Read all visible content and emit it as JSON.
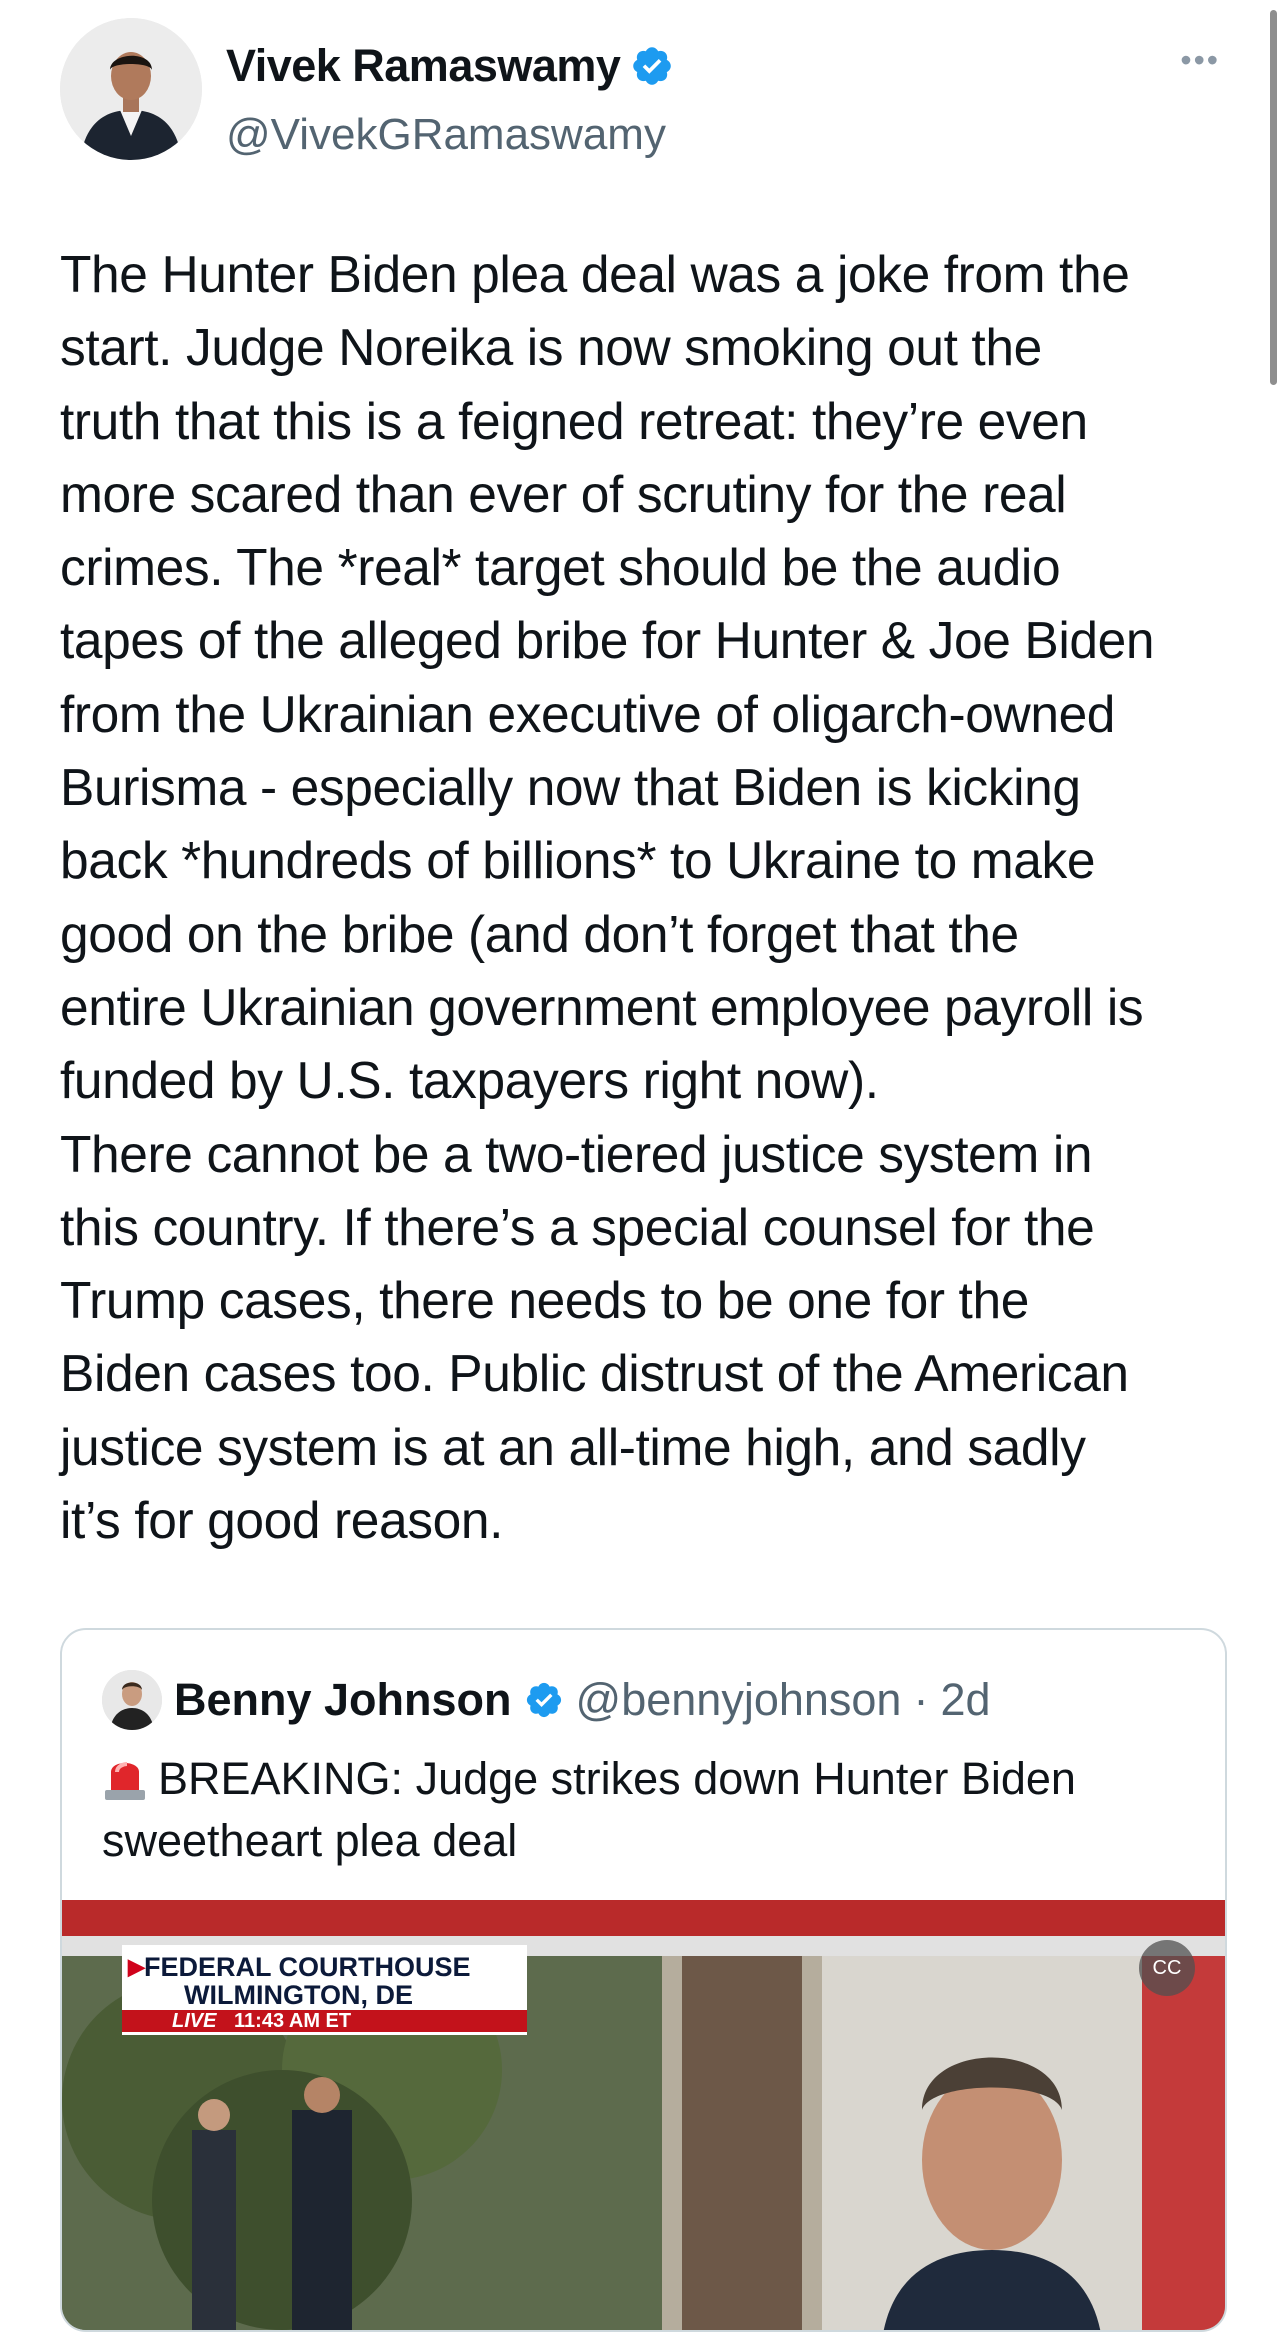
{
  "author": {
    "name": "Vivek Ramaswamy",
    "handle": "@VivekGRamaswamy",
    "verified_icon": "verified-badge-icon",
    "verified_color": "#1d9bf0"
  },
  "more_icon": "more-options-icon",
  "tweet_text": "The Hunter Biden plea deal was a joke from the\nstart. Judge Noreika is now smoking out the\ntruth that this is a feigned retreat: they’re even\nmore scared than ever of scrutiny for the real\ncrimes. The *real* target should be the audio\ntapes of the alleged bribe for Hunter & Joe Biden\nfrom the Ukrainian executive of oligarch-owned\nBurisma - especially now that Biden is kicking\nback *hundreds of billions* to Ukraine to make\ngood on the bribe (and don’t forget that the\nentire Ukrainian government employee payroll is\nfunded by U.S. taxpayers right now).\nThere cannot be a two-tiered justice system in\nthis country. If there’s a special counsel for the\nTrump cases, there needs to be one for the\nBiden cases too. Public distrust of the American\njustice system is at an all-time high, and sadly\nit’s for good reason.",
  "quoted_tweet": {
    "name": "Benny Johnson",
    "handle": "@bennyjohnson",
    "separator": "·",
    "time": "2d",
    "emoji": "siren-emoji",
    "text": "BREAKING: Judge strikes down Hunter Biden sweetheart plea deal",
    "media": {
      "banner_line1": "FEDERAL COURTHOUSE",
      "banner_line2": "WILMINGTON, DE",
      "live": "LIVE",
      "time": "11:43 AM ET",
      "cc_icon": "captions-icon",
      "cc_label": "CC"
    }
  }
}
